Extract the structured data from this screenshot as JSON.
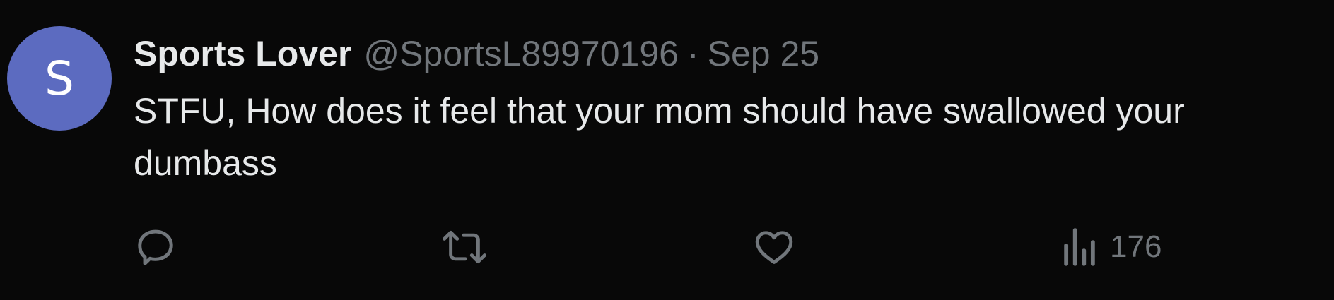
{
  "author": {
    "avatar_letter": "S",
    "avatar_color": "#5c6bc0",
    "display_name": "Sports Lover",
    "handle": "@SportsL89970196",
    "separator": "·",
    "date": "Sep 25"
  },
  "tweet": {
    "text": "STFU, How does it feel that your mom should have swallowed your dumbass"
  },
  "actions": {
    "reply_icon": "reply-icon",
    "retweet_icon": "retweet-icon",
    "like_icon": "like-icon",
    "views_icon": "views-icon",
    "views_count": "176"
  },
  "colors": {
    "background": "#080808",
    "text_primary": "#e7e9ea",
    "text_secondary": "#71767b"
  }
}
